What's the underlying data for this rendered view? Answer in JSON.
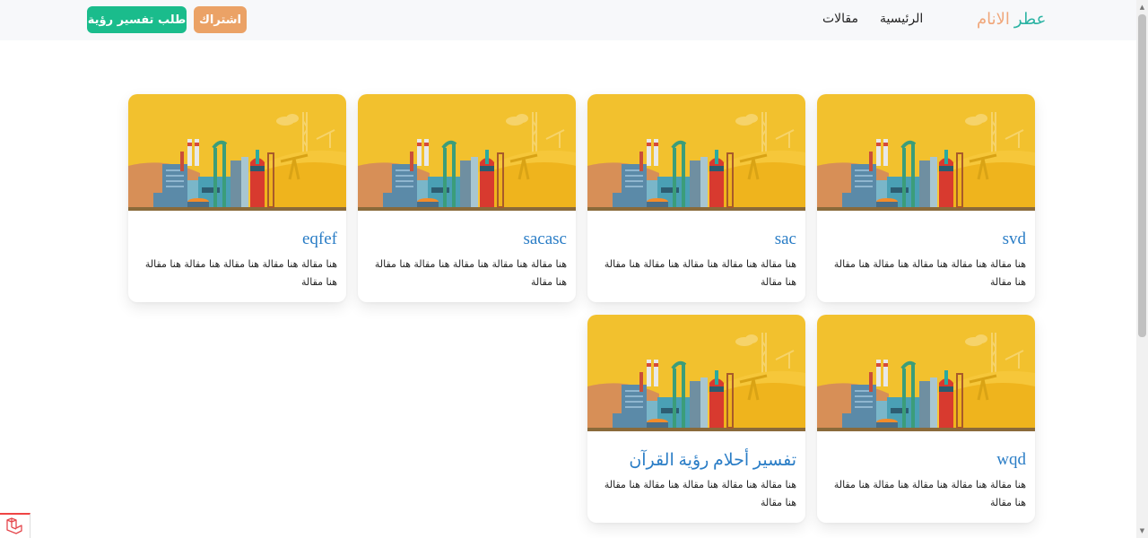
{
  "navbar": {
    "brand_part1": "عطر",
    "brand_part2": "الانام",
    "links": [
      "الرئيسية",
      "مقالات"
    ],
    "request_button": "طلب تفسير رؤية",
    "subscribe_button": "اشتراك"
  },
  "cards": [
    {
      "title": "svd",
      "text": "هنا مقالة هنا مقالة هنا مقالة هنا مقالة هنا مقالة هنا مقالة"
    },
    {
      "title": "sac",
      "text": "هنا مقالة هنا مقالة هنا مقالة هنا مقالة هنا مقالة هنا مقالة"
    },
    {
      "title": "sacasc",
      "text": "هنا مقالة هنا مقالة هنا مقالة هنا مقالة هنا مقالة هنا مقالة"
    },
    {
      "title": "eqfef",
      "text": "هنا مقالة هنا مقالة هنا مقالة هنا مقالة هنا مقالة هنا مقالة"
    },
    {
      "title": "wqd",
      "text": "هنا مقالة هنا مقالة هنا مقالة هنا مقالة هنا مقالة هنا مقالة"
    },
    {
      "title": "تفسير أحلام رؤية القرآن",
      "text": "هنا مقالة هنا مقالة هنا مقالة هنا مقالة هنا مقالة هنا مقالة"
    }
  ],
  "colors": {
    "brand_teal": "#2bb3a3",
    "brand_orange": "#f0a77b",
    "button_green": "#1abc8c",
    "button_orange": "#eba266",
    "card_title_blue": "#2a7dc6",
    "image_yellow": "#f2c12e"
  },
  "icons": [
    "factory-illustration",
    "laravel-icon",
    "scroll-up-arrow-icon",
    "scroll-down-arrow-icon"
  ]
}
